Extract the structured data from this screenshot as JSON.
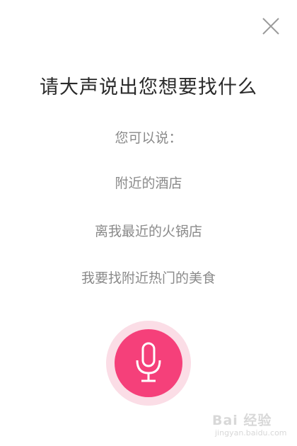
{
  "dialog": {
    "title": "请大声说出您想要找什么",
    "hint_label": "您可以说：",
    "suggestions": [
      "附近的酒店",
      "离我最近的火锅店",
      "我要找附近热门的美食"
    ]
  },
  "icons": {
    "close": "close-icon",
    "mic": "microphone-icon"
  },
  "colors": {
    "accent": "#f5407a",
    "halo": "#fbdde6",
    "title_text": "#2a2a2a",
    "hint_text": "#8a8a8a"
  },
  "watermark": {
    "brand": "Bai 经验",
    "site": "jingyan.baidu.com"
  }
}
